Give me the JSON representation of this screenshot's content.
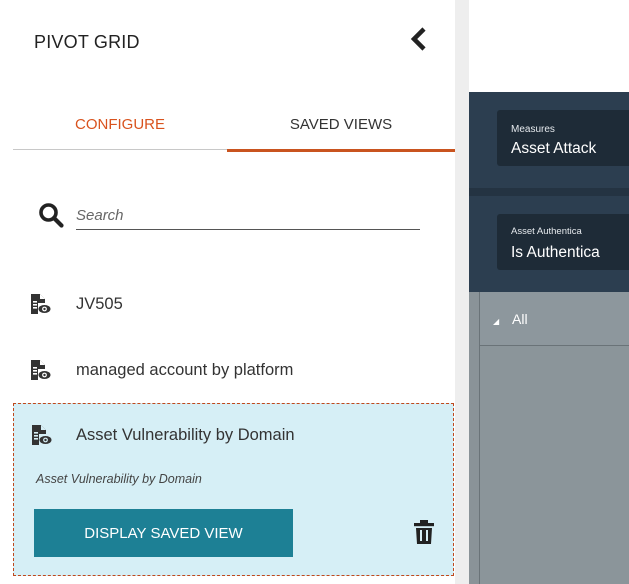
{
  "panel": {
    "title": "PIVOT GRID",
    "collapse_icon": "chevron-left-icon"
  },
  "tabs": {
    "configure": "CONFIGURE",
    "saved_views": "SAVED VIEWS",
    "active": "saved_views"
  },
  "search": {
    "placeholder": "Search",
    "value": ""
  },
  "saved_views": [
    {
      "label": "JV505",
      "icon": "saved-view-document-icon"
    },
    {
      "label": "managed account by platform",
      "icon": "saved-view-document-icon"
    },
    {
      "label": "Asset Vulnerability by Domain",
      "icon": "saved-view-document-icon",
      "selected": true,
      "description": "Asset Vulnerability by Domain"
    }
  ],
  "selected_actions": {
    "display_label": "DISPLAY SAVED VIEW",
    "delete_icon": "trash-icon"
  },
  "grid": {
    "fields": [
      {
        "caption": "Measures",
        "value": "Asset Attack"
      },
      {
        "caption": "Asset Authentica",
        "value": "Is Authentica"
      }
    ],
    "row_header": "All"
  },
  "colors": {
    "accent_orange": "#d9531e",
    "button_teal": "#1d8095",
    "selected_bg": "#d6eff6",
    "grid_header": "#2c3e50",
    "grid_body": "#8a9398"
  }
}
